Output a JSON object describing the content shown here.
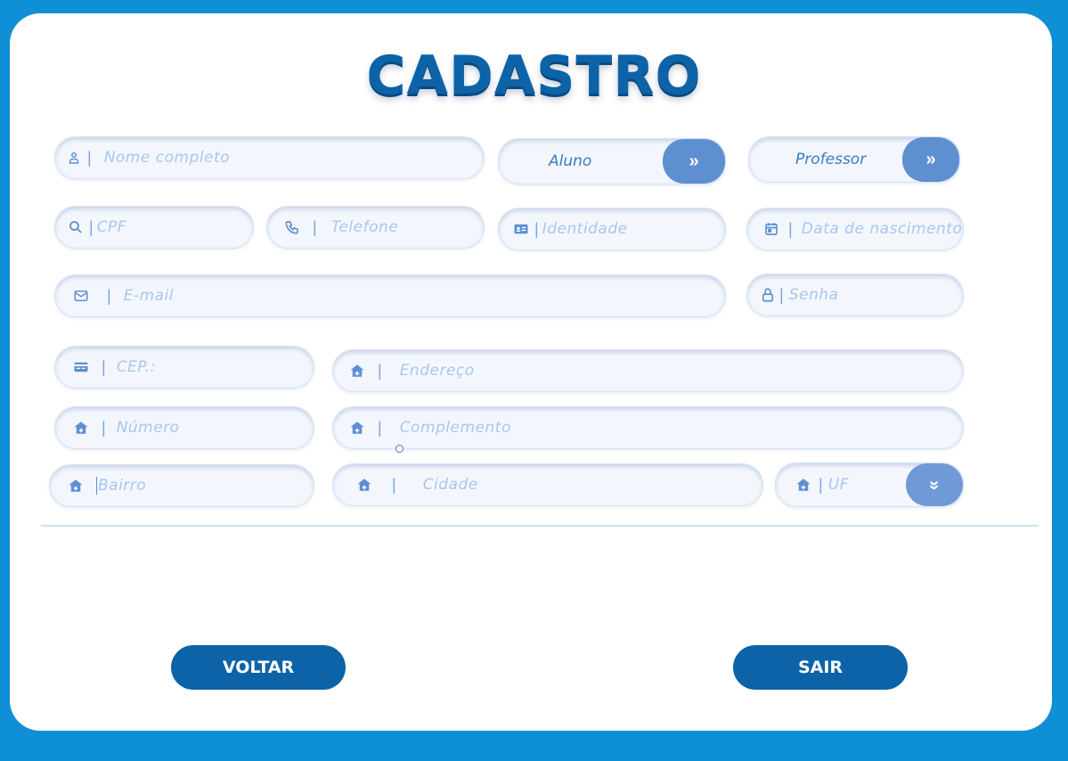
{
  "title": "CADASTRO",
  "colors": {
    "background": "#0f8fd6",
    "primary": "#0d63a8",
    "accent": "#5d8fd1",
    "placeholder": "#a9c6ee"
  },
  "fields": {
    "nome": {
      "icon": "person-icon",
      "placeholder": "Nome completo"
    },
    "cpf": {
      "icon": "search-icon",
      "placeholder": "CPF"
    },
    "telefone": {
      "icon": "phone-icon",
      "placeholder": "Telefone"
    },
    "identidade": {
      "icon": "id-card-icon",
      "placeholder": "Identidade"
    },
    "nascimento": {
      "icon": "calendar-icon",
      "placeholder": "Data de nascimento"
    },
    "email": {
      "icon": "mail-icon",
      "placeholder": "E-mail"
    },
    "senha": {
      "icon": "lock-icon",
      "placeholder": "Senha"
    },
    "cep": {
      "icon": "card-icon",
      "placeholder": "CEP.:"
    },
    "endereco": {
      "icon": "home-icon",
      "placeholder": "Endereço"
    },
    "numero": {
      "icon": "home-icon",
      "placeholder": "Número"
    },
    "complemento": {
      "icon": "home-icon",
      "placeholder": "Complemento"
    },
    "bairro": {
      "icon": "home-icon",
      "placeholder": "Bairro"
    },
    "cidade": {
      "icon": "home-icon",
      "placeholder": "Cidade"
    },
    "uf": {
      "icon": "home-icon",
      "placeholder": "UF"
    }
  },
  "selectors": {
    "aluno": {
      "label": "Aluno",
      "icon": "double-chevron-right-icon"
    },
    "professor": {
      "label": "Professor",
      "icon": "double-chevron-right-icon"
    },
    "uf_toggle": {
      "icon": "double-chevron-down-icon"
    }
  },
  "actions": {
    "voltar": "VOLTAR",
    "sair": "SAIR"
  }
}
